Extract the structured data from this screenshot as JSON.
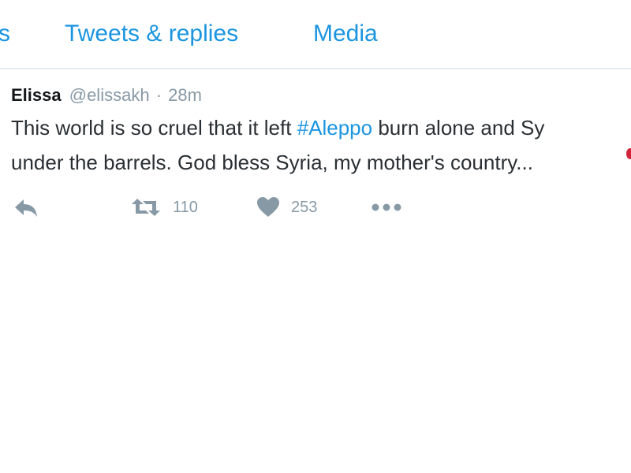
{
  "tabs": [
    {
      "label": "s"
    },
    {
      "label": "Tweets & replies"
    },
    {
      "label": "Media"
    }
  ],
  "tweet": {
    "name": "Elissa",
    "handle": "@elissakh",
    "separator": "·",
    "time": "28m",
    "text_line1_before": "This world is so cruel that it left ",
    "hashtag": "#Aleppo",
    "text_line1_after": " burn alone and Sy",
    "text_line2": "under the barrels. God bless Syria, my mother's country...",
    "retweet_count": "110",
    "like_count": "253"
  },
  "icons": {
    "reply": "reply-icon",
    "retweet": "retweet-icon",
    "like": "heart-icon",
    "more": "more-icon"
  },
  "colors": {
    "link": "#1b95e0",
    "muted": "#8899a6",
    "text": "#292f33",
    "emoji": "#d0263b"
  }
}
